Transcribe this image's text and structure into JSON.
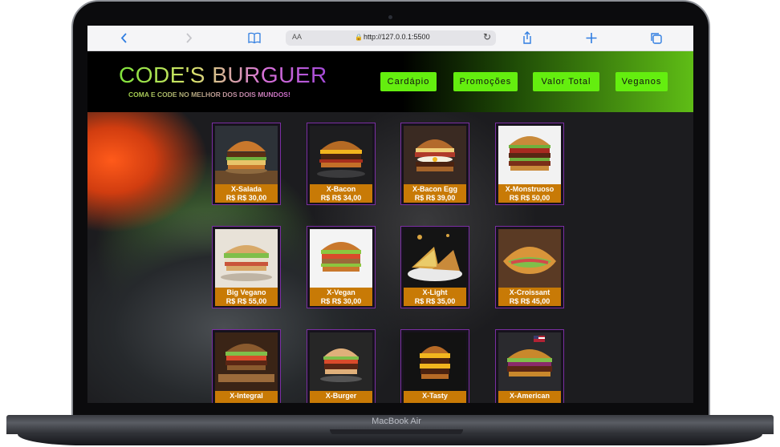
{
  "device": {
    "model_label": "MacBook Air"
  },
  "browser": {
    "back_icon": "chevron-left-icon",
    "forward_icon": "chevron-right-icon",
    "reader_icon": "book-icon",
    "text_size_label": "AA",
    "lock_icon": "lock-icon",
    "url": "http://127.0.0.1:5500",
    "reload_icon": "reload-icon",
    "share_icon": "share-icon",
    "new_tab_icon": "plus-icon",
    "tabs_icon": "tabs-icon"
  },
  "site": {
    "title": "CODE'S BURGUER",
    "tagline": "COMA E CODE NO MELHOR DOS DOIS MUNDOS!",
    "nav": [
      "Cardápio",
      "Promoções",
      "Valor Total",
      "Veganos"
    ],
    "accent_color": "#64ee0f",
    "caption_color": "#c87a06",
    "card_border_color": "#7b2ea3"
  },
  "products": [
    {
      "name": "X-Salada",
      "price": "R$ R$ 30,00"
    },
    {
      "name": "X-Bacon",
      "price": "R$ R$ 34,00"
    },
    {
      "name": "X-Bacon Egg",
      "price": "R$ R$ 39,00"
    },
    {
      "name": "X-Monstruoso",
      "price": "R$ R$ 50,00"
    },
    {
      "name": "Big Vegano",
      "price": "R$ R$ 55,00"
    },
    {
      "name": "X-Vegan",
      "price": "R$ R$ 30,00"
    },
    {
      "name": "X-Light",
      "price": "R$ R$ 35,00"
    },
    {
      "name": "X-Croissant",
      "price": "R$ R$ 45,00"
    },
    {
      "name": "X-Integral",
      "price": ""
    },
    {
      "name": "X-Burger",
      "price": ""
    },
    {
      "name": "X-Tasty",
      "price": ""
    },
    {
      "name": "X-American",
      "price": ""
    }
  ]
}
